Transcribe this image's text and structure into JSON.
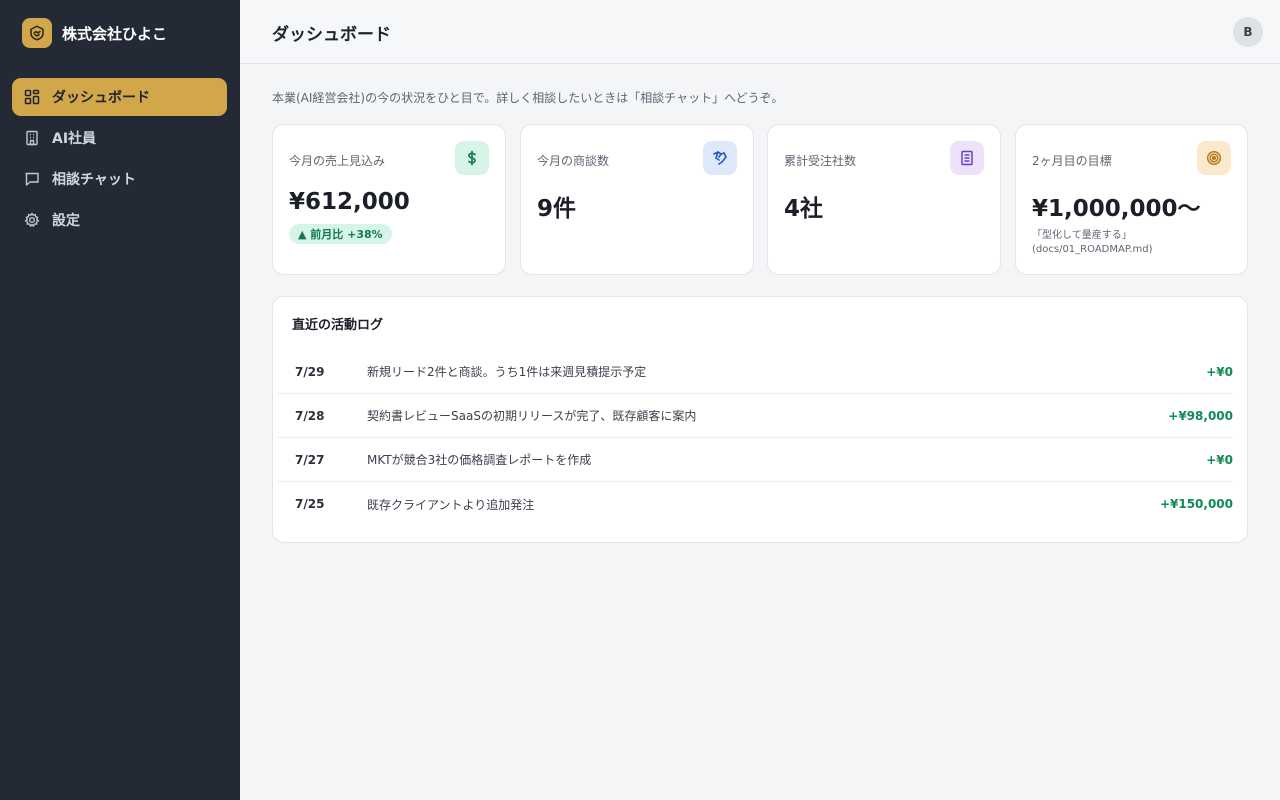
{
  "sidebar": {
    "brand_name": "株式会社ひよこ",
    "items": [
      {
        "label": "ダッシュボード",
        "icon": "grid-icon",
        "active": true
      },
      {
        "label": "AI社員",
        "icon": "building-icon",
        "active": false
      },
      {
        "label": "相談チャット",
        "icon": "chat-icon",
        "active": false
      },
      {
        "label": "設定",
        "icon": "gear-icon",
        "active": false
      }
    ]
  },
  "header": {
    "title": "ダッシュボード",
    "avatar_initial": "B"
  },
  "intro": "本業(AI経営会社)の今の状況をひと目で。詳しく相談したいときは「相談チャット」へどうぞ。",
  "stats": [
    {
      "label": "今月の売上見込み",
      "value": "¥612,000",
      "badge": "▲ 前月比 +38%",
      "icon": "dollar-icon",
      "icon_bg": "#d6f5e6",
      "icon_color": "#127a4a"
    },
    {
      "label": "今月の商談数",
      "value": "9件",
      "icon": "handshake-icon",
      "icon_bg": "#dde8fb",
      "icon_color": "#2457c5"
    },
    {
      "label": "累計受注社数",
      "value": "4社",
      "icon": "document-icon",
      "icon_bg": "#ece3fb",
      "icon_color": "#6b3fc2"
    },
    {
      "label": "2ヶ月目の目標",
      "value": "¥1,000,000〜",
      "note_1": "「型化して量産する」",
      "note_2": "(docs/01_ROADMAP.md)",
      "icon": "target-icon",
      "icon_bg": "#fbe9cc",
      "icon_color": "#b8791c"
    }
  ],
  "activity": {
    "title": "直近の活動ログ",
    "rows": [
      {
        "date": "7/29",
        "text": "新規リード2件と商談。うち1件は来週見積提示予定",
        "amount": "+¥0"
      },
      {
        "date": "7/28",
        "text": "契約書レビューSaaSの初期リリースが完了、既存顧客に案内",
        "amount": "+¥98,000"
      },
      {
        "date": "7/27",
        "text": "MKTが競合3社の価格調査レポートを作成",
        "amount": "+¥0"
      },
      {
        "date": "7/25",
        "text": "既存クライアントより追加発注",
        "amount": "+¥150,000"
      }
    ]
  },
  "colors": {
    "sidebar_bg": "#242a35",
    "accent": "#d1a74a",
    "positive": "#0f8a55"
  }
}
